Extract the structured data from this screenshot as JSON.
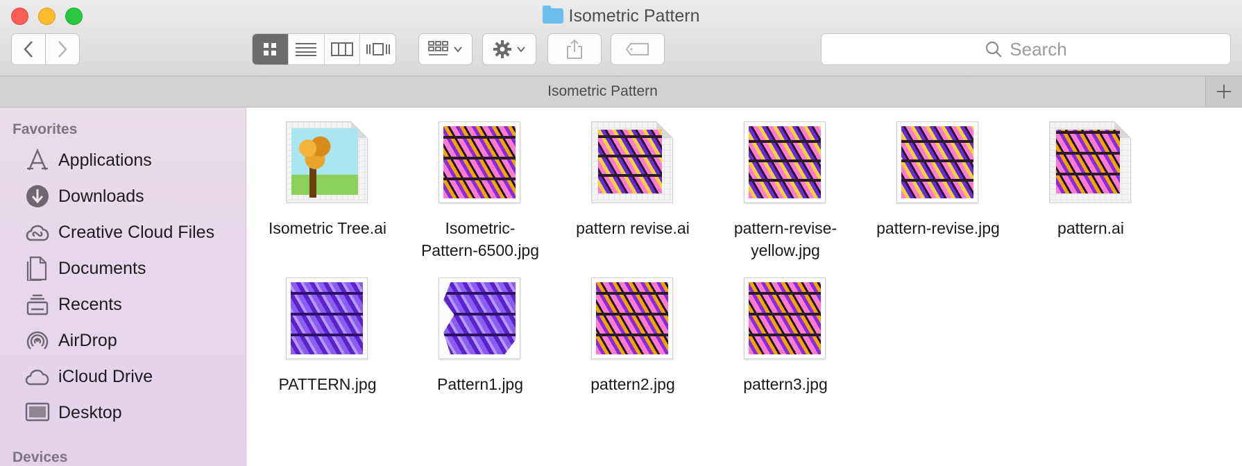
{
  "window": {
    "title": "Isometric Pattern",
    "folder_icon": "folder-icon"
  },
  "toolbar": {
    "back_icon": "chevron-left-icon",
    "forward_icon": "chevron-right-icon",
    "views": [
      "icon-view-icon",
      "list-view-icon",
      "column-view-icon",
      "cover-flow-icon"
    ],
    "arrange_icon": "arrange-icon",
    "action_icon": "gear-icon",
    "share_icon": "share-icon",
    "tag_icon": "tag-icon",
    "search_placeholder": "Search"
  },
  "tabbar": {
    "title": "Isometric Pattern",
    "add_icon": "plus-icon"
  },
  "sidebar": {
    "favorites_header": "Favorites",
    "devices_header": "Devices",
    "items": [
      {
        "label": "Applications",
        "icon": "applications-icon"
      },
      {
        "label": "Downloads",
        "icon": "downloads-icon"
      },
      {
        "label": "Creative Cloud Files",
        "icon": "creative-cloud-icon"
      },
      {
        "label": "Documents",
        "icon": "documents-icon"
      },
      {
        "label": "Recents",
        "icon": "recents-icon"
      },
      {
        "label": "AirDrop",
        "icon": "airdrop-icon"
      },
      {
        "label": "iCloud Drive",
        "icon": "icloud-icon"
      },
      {
        "label": "Desktop",
        "icon": "desktop-icon"
      }
    ]
  },
  "files": [
    {
      "line1": "Isometric Tree.ai",
      "line2": ""
    },
    {
      "line1": "Isometric-",
      "line2": "Pattern-6500.jpg"
    },
    {
      "line1": "pattern revise.ai",
      "line2": ""
    },
    {
      "line1": "pattern-revise-",
      "line2": "yellow.jpg"
    },
    {
      "line1": "pattern-revise.jpg",
      "line2": ""
    },
    {
      "line1": "pattern.ai",
      "line2": ""
    },
    {
      "line1": "PATTERN.jpg",
      "line2": ""
    },
    {
      "line1": "Pattern1.jpg",
      "line2": ""
    },
    {
      "line1": "pattern2.jpg",
      "line2": ""
    },
    {
      "line1": "pattern3.jpg",
      "line2": ""
    }
  ],
  "colors": {
    "sidebar_top": "#e9dde8",
    "sidebar_bottom": "#e3d2ec",
    "active_view": "#6b6b6b"
  }
}
